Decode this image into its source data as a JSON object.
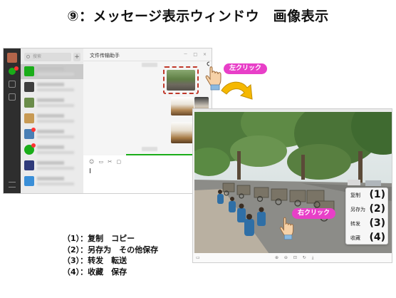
{
  "slide": {
    "title": "⑨：メッセージ表示ウィンドウ　画像表示"
  },
  "chat_window": {
    "title": "文件传输助手",
    "window_controls": "－ □ ×",
    "search_placeholder": "搜索",
    "add_button": "+",
    "toolbar_icons": [
      "emoji-icon",
      "folder-icon",
      "scissors-icon",
      "chat-bubble-icon"
    ],
    "toolbar_text": "☺ ▭ ✂ ▢"
  },
  "callouts": {
    "left_click": "左クリック",
    "right_click": "右クリック"
  },
  "context_menu": {
    "items": [
      {
        "label": "复制",
        "num": "(1)"
      },
      {
        "label": "另存为",
        "num": "(2)"
      },
      {
        "label": "转发",
        "num": "(3)"
      },
      {
        "label": "收藏",
        "num": "(4)"
      }
    ]
  },
  "viewer_bar": {
    "left_icon": "▭",
    "center_icons": "⊕ ⊖ ⊡ ↻ ⤓"
  },
  "legend": [
    "（1）：复制　コピー",
    "（2）：另存为　その他保存",
    "（3）：转发　転送",
    "（4）：收藏　保存"
  ],
  "colors": {
    "accent_label": "#e83fc8",
    "highlight_border": "#c0392b",
    "arrow": "#f5b800",
    "wechat_green": "#1aad19"
  }
}
